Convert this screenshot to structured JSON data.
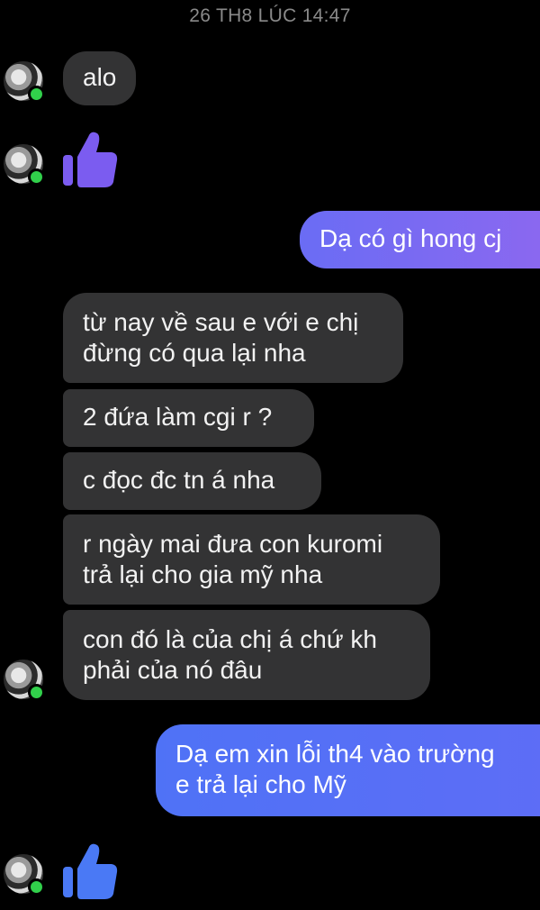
{
  "timestamp": "26 TH8 LÚC 14:47",
  "colors": {
    "background": "#000000",
    "incoming_bubble": "#333334",
    "outgoing_purple": "#8068f2",
    "outgoing_blue": "#566ff6",
    "online_dot": "#31d04b",
    "like_purple": "#7b5cf0",
    "like_blue": "#4a79f5"
  },
  "messages": [
    {
      "sender": "other",
      "text": "alo"
    },
    {
      "sender": "other",
      "type": "like",
      "icon": "thumbs-up-icon"
    },
    {
      "sender": "me",
      "text": "Dạ  có gì hong cj"
    },
    {
      "sender": "other",
      "text": "từ nay về sau e với e chị\nđừng có qua lại nha"
    },
    {
      "sender": "other",
      "text": "2 đứa làm cgi r ?"
    },
    {
      "sender": "other",
      "text": "c đọc đc tn á nha"
    },
    {
      "sender": "other",
      "text": "r ngày mai đưa con kuromi\ntrả lại cho gia mỹ nha"
    },
    {
      "sender": "other",
      "text": "con đó là của chị á chứ kh\nphải của nó đâu"
    },
    {
      "sender": "me",
      "text": "Dạ em xin lỗi th4 vào trường\ne trả lại cho Mỹ"
    },
    {
      "sender": "other",
      "type": "like",
      "icon": "thumbs-up-icon"
    }
  ]
}
